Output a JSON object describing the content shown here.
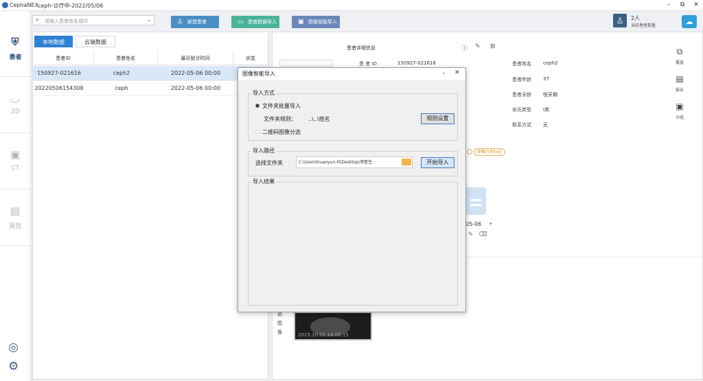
{
  "window": {
    "app_name": "CephaNEX",
    "path": "ceph-诊疗中-2022/05/06",
    "min": "–",
    "max": "⧉",
    "close": "✕"
  },
  "nav": [
    {
      "label": "患者",
      "icon": "patient-icon",
      "glyph": "⛨"
    },
    {
      "label": "2D",
      "icon": "2d-icon",
      "glyph": "◡"
    },
    {
      "label": "CT",
      "icon": "ct-icon",
      "glyph": "▣"
    },
    {
      "label": "报告",
      "icon": "report-icon",
      "glyph": "▤"
    }
  ],
  "nav_bottom": {
    "user_glyph": "◎",
    "settings_glyph": "⚙"
  },
  "search": {
    "placeholder": "请输入患者姓名或ID"
  },
  "toolbar": {
    "new_patient": "新建患者",
    "import_data": "患者数据导入",
    "smart_import": "图像智能导入"
  },
  "patient_count": {
    "value": "2人",
    "label": "当前患者数量"
  },
  "tabs": {
    "local": "本地数据",
    "cloud": "云端数据"
  },
  "table": {
    "headers": [
      "患者ID",
      "患者姓名",
      "最近就诊时间",
      "状态"
    ],
    "rows": [
      {
        "id": "150927-021616",
        "name": "ceph2",
        "time": "2022-05-06 00:00",
        "selected": true
      },
      {
        "id": "20220506154308",
        "name": "ceph",
        "time": "2022-05-06 00:00",
        "selected": false
      }
    ]
  },
  "detail": {
    "title": "患者详细信息",
    "fields_left": [
      {
        "label": "患 者  ID",
        "value": "150927-021616"
      }
    ],
    "fields_right": [
      {
        "label": "患者姓名",
        "value": "ceph2"
      },
      {
        "label": "患者年龄",
        "value": "37"
      },
      {
        "label": "患者牙龄",
        "value": "恒牙期"
      },
      {
        "label": "安氏类型",
        "value": "I类"
      },
      {
        "label": "联系方式",
        "value": "无"
      }
    ],
    "date_fragment": "05-06",
    "badge_text": "图像已有标记",
    "side_actions": [
      "覆盖",
      "报告",
      "分组"
    ],
    "thumb_caption": "2015.10.02 14:00:15",
    "image_label": [
      "协",
      "图",
      "像"
    ]
  },
  "dialog": {
    "title": "图像智能导入",
    "group_mode": "导入方式",
    "opt_batch": "文件夹批量导入",
    "folder_rule_label": "文件夹规则：",
    "folder_rule_value": "..\\..\\姓名",
    "rule_button": "规则设置",
    "opt_qrcode": "二维码图像分选",
    "group_path": "导入路径",
    "choose_folder": "选择文件夹",
    "folder_path": "C:\\Users\\huaoyun-lil\\Desktop\\李医生",
    "start_button": "开始导入",
    "group_result": "导入结果"
  },
  "colors": {
    "accent": "#2e80d4",
    "btn_new": "#4a8fc4",
    "btn_import": "#4ab39a",
    "btn_smart": "#6b86b8",
    "nav_active": "#2f5477"
  }
}
